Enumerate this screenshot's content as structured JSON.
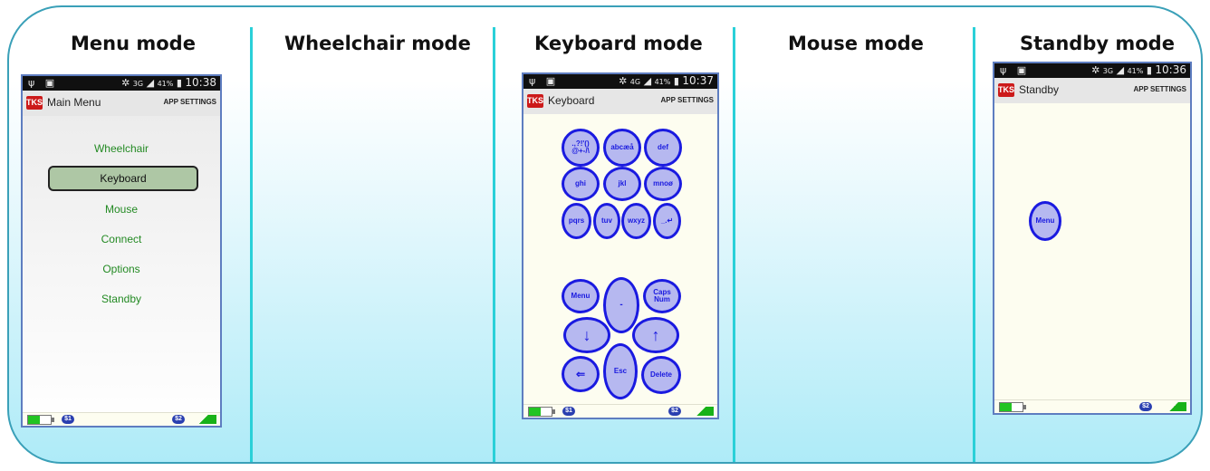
{
  "panels": [
    {
      "title": "Menu mode"
    },
    {
      "title": "Wheelchair mode"
    },
    {
      "title": "Keyboard mode"
    },
    {
      "title": "Mouse mode"
    },
    {
      "title": "Standby mode"
    }
  ],
  "phones": {
    "menu": {
      "status_time": "10:38",
      "status_battery": "41%",
      "status_network": "3G",
      "app_badge": "TKS",
      "screen_title": "Main Menu",
      "settings_label": "APP SETTINGS",
      "items": [
        "Wheelchair",
        "Keyboard",
        "Mouse",
        "Connect",
        "Options",
        "Standby"
      ],
      "selected": "Keyboard",
      "chip1": "$1",
      "chip2": "$2"
    },
    "keyboard": {
      "status_time": "10:37",
      "status_battery": "41%",
      "status_network": "4G",
      "app_badge": "TKS",
      "screen_title": "Keyboard",
      "settings_label": "APP SETTINGS",
      "keys": [
        ".,?!'()\n@+-/\\",
        "abcæå",
        "def",
        "ghi",
        "jkl",
        "mnoø",
        "pqrs",
        "tuv",
        "wxyz",
        "_.↵",
        "Menu",
        "-",
        "Caps\nNum",
        "↓",
        "↑",
        "⇐",
        "Esc",
        "Delete"
      ],
      "chip1": "$1",
      "chip2": "$2"
    },
    "standby": {
      "status_time": "10:36",
      "status_battery": "41%",
      "status_network": "3G",
      "app_badge": "TKS",
      "screen_title": "Standby",
      "settings_label": "APP SETTINGS",
      "menu_button": "Menu",
      "chip2": "$2"
    }
  },
  "colors": {
    "frame_border": "#3aa0b8",
    "separator": "#2ad0d8",
    "menu_text": "#238a23",
    "key_border": "#1a1ae0",
    "key_fill": "#b6b8f0"
  }
}
